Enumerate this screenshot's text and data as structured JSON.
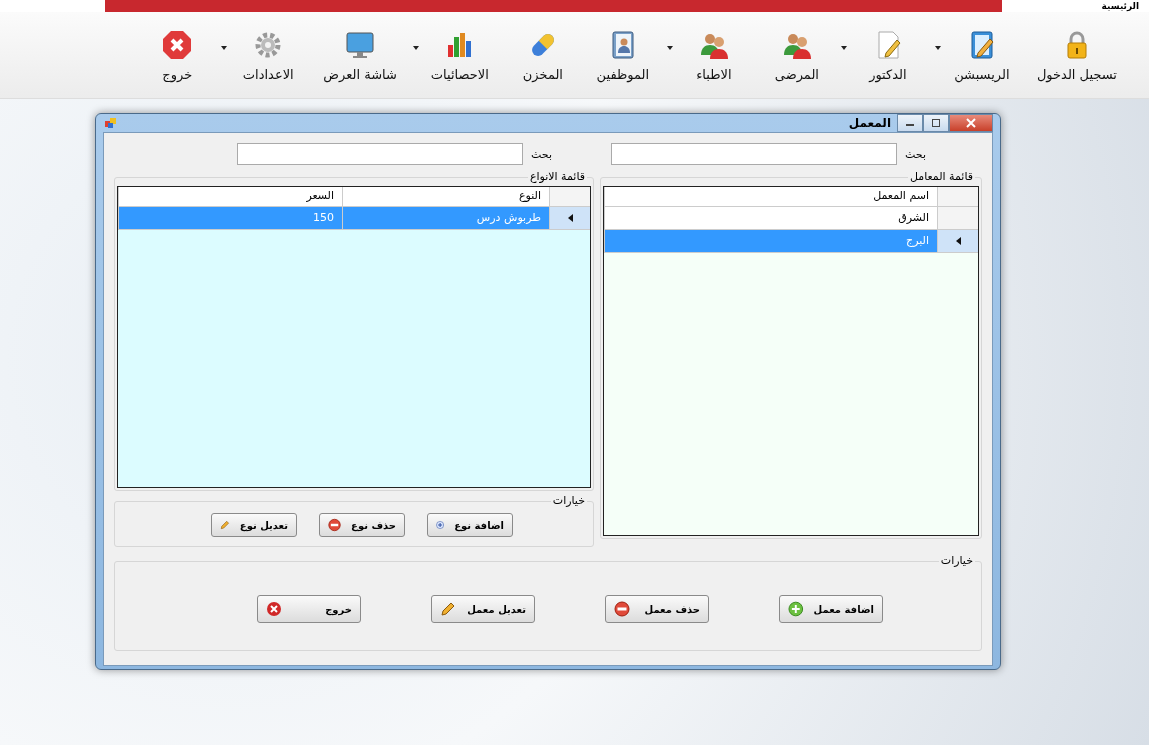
{
  "app_title": "الرئيسية",
  "toolbar": [
    {
      "label": "تسجيل الدخول",
      "kind": "lock",
      "dropdown": false
    },
    {
      "label": "الريسبشن",
      "kind": "notebook",
      "dropdown": true
    },
    {
      "label": "الدكتور",
      "kind": "document",
      "dropdown": true
    },
    {
      "label": "المرضى",
      "kind": "people",
      "dropdown": false
    },
    {
      "label": "الاطباء",
      "kind": "people",
      "dropdown": true
    },
    {
      "label": "الموظفين",
      "kind": "addressbook",
      "dropdown": false
    },
    {
      "label": "المخزن",
      "kind": "pill",
      "dropdown": false
    },
    {
      "label": "الاحصائيات",
      "kind": "chart",
      "dropdown": true
    },
    {
      "label": "شاشة العرض",
      "kind": "monitor",
      "dropdown": false
    },
    {
      "label": "الاعدادات",
      "kind": "gear",
      "dropdown": true
    },
    {
      "label": "خروج",
      "kind": "exit",
      "dropdown": false
    }
  ],
  "dialog": {
    "title": "المعمل",
    "labs_search": {
      "label": "بحث"
    },
    "types_search": {
      "label": "بحث"
    },
    "labs_list": {
      "title": "قائمة المعامل",
      "columns": [
        "اسم المعمل"
      ],
      "rows": [
        {
          "cells": [
            "الشرق"
          ],
          "selected": false
        },
        {
          "cells": [
            "البرج"
          ],
          "selected": true
        }
      ]
    },
    "types_list": {
      "title": "قائمة الانواع",
      "columns": [
        "النوع",
        "السعر"
      ],
      "rows": [
        {
          "cells": [
            "طربوش  درس",
            "150"
          ],
          "selected": true
        }
      ]
    },
    "types_options": {
      "title": "خيارات",
      "buttons": [
        {
          "label": "اضافة نوع",
          "kind": "add-blue"
        },
        {
          "label": "حذف نوع",
          "kind": "remove"
        },
        {
          "label": "تعديل نوع",
          "kind": "pencil"
        }
      ]
    },
    "lab_options": {
      "title": "خيارات",
      "buttons": [
        {
          "label": "اضافة معمل",
          "kind": "add-green"
        },
        {
          "label": "حذف معمل",
          "kind": "remove"
        },
        {
          "label": "تعديل معمل",
          "kind": "pencil"
        },
        {
          "label": "خروج",
          "kind": "close"
        }
      ]
    }
  }
}
